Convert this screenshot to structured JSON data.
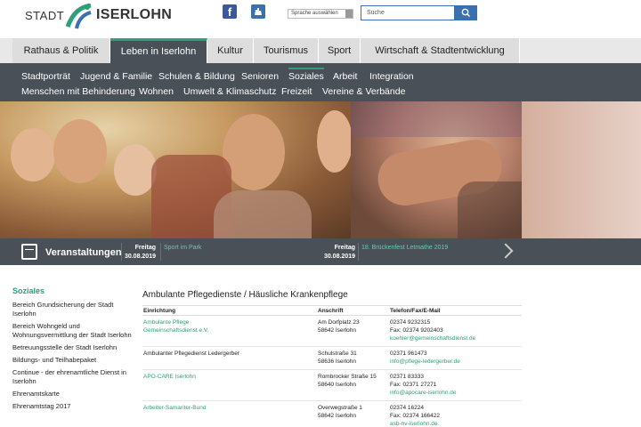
{
  "header": {
    "logo_part1": "STADT",
    "logo_part2": "ISERLOHN",
    "social": {
      "facebook": "f"
    },
    "language_select": "Sprache auswählen",
    "search_placeholder": "Suche",
    "icons": [
      "facebook-icon",
      "sign-language-icon",
      "search-icon"
    ]
  },
  "main_nav": [
    {
      "label": "Rathaus & Politik",
      "active": false
    },
    {
      "label": "Leben in Iserlohn",
      "active": true
    },
    {
      "label": "Kultur",
      "active": false
    },
    {
      "label": "Tourismus",
      "active": false
    },
    {
      "label": "Sport",
      "active": false
    },
    {
      "label": "Wirtschaft & Stadtentwicklung",
      "active": false
    }
  ],
  "sub_nav_row1": [
    {
      "label": "Stadtporträt",
      "active": false
    },
    {
      "label": "Jugend & Familie",
      "active": false
    },
    {
      "label": "Schulen & Bildung",
      "active": false
    },
    {
      "label": "Senioren",
      "active": false
    },
    {
      "label": "Soziales",
      "active": true
    },
    {
      "label": "Arbeit",
      "active": false
    },
    {
      "label": "Integration",
      "active": false
    }
  ],
  "sub_nav_row2": [
    {
      "label": "Menschen mit Behinderung"
    },
    {
      "label": "Wohnen"
    },
    {
      "label": "Umwelt & Klimaschutz"
    },
    {
      "label": "Freizeit"
    },
    {
      "label": "Vereine & Verbände"
    }
  ],
  "events": {
    "label": "Veranstaltungen",
    "items": [
      {
        "day": "Freitag",
        "date": "30.08.2019",
        "title": "Sport im Park"
      },
      {
        "day": "Freitag",
        "date": "30.08.2019",
        "title": "18. Brückenfest Letmathe 2019"
      }
    ]
  },
  "sidebar": {
    "heading": "Soziales",
    "links": [
      "Bereich Grundsicherung der Stadt Iserlohn",
      "Bereich Wohngeld und Wohnungsvermittlung der Stadt Iserlohn",
      "Betreuungsstelle der Stadt Iserlohn",
      "Bildungs- und Teilhabepaket",
      "Continue - der ehrenamtliche Dienst in Iserlohn",
      "Ehrenamtskarte",
      "Ehrenamtstag 2017"
    ]
  },
  "content": {
    "title": "Ambulante Pflegedienste / Häusliche Krankenpflege",
    "columns": [
      "Einrichtung",
      "Anschrift",
      "Telefon/Fax/E-Mail"
    ],
    "rows": [
      {
        "name1": "Ambulante Pflege",
        "name2": "Gemeinschaftsdienst e.V.",
        "name_link": true,
        "addr1": "Am Dorfplatz 23",
        "addr2": "58642 Iserlohn",
        "tel": "02374 9232315",
        "fax": "Fax: 02374 9202403",
        "email": "koehler@gemeinschaftsdienst.de"
      },
      {
        "name1": "Ambulanter Pflegedienst Ledergerber",
        "name2": "",
        "name_link": false,
        "addr1": "Schulstraße 31",
        "addr2": "58636 Iserlohn",
        "tel": "02371 961473",
        "fax": "",
        "email": "info@pflege-ledergerber.de"
      },
      {
        "name1": "APO-CARE Iserlohn",
        "name2": "",
        "name_link": true,
        "addr1": "Rombrocker Straße 15",
        "addr2": "58640 Iserlohn",
        "tel": "02371 83333",
        "fax": "Fax: 02371 27271",
        "email": "info@apocare-iserlohn.de"
      },
      {
        "name1": "Arbeiter-Samariter-Bund",
        "name2": "",
        "name_link": true,
        "addr1": "Overwegstraße 1",
        "addr2": "58642 Iserlohn",
        "tel": "02374 16224",
        "fax": "Fax: 02374 166422",
        "email": "asb-nv-iserlohn.de"
      }
    ]
  }
}
